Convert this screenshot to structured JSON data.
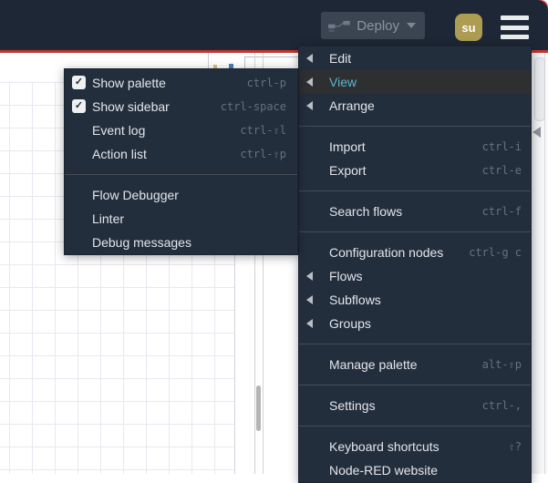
{
  "header": {
    "deploy_label": "Deploy",
    "avatar_initials": "su"
  },
  "main_menu": {
    "items": [
      {
        "label": "Edit",
        "submenu": true
      },
      {
        "label": "View",
        "submenu": true,
        "active": true
      },
      {
        "label": "Arrange",
        "submenu": true
      },
      {
        "separator": true
      },
      {
        "label": "Import",
        "shortcut": "ctrl-i"
      },
      {
        "label": "Export",
        "shortcut": "ctrl-e"
      },
      {
        "separator": true
      },
      {
        "label": "Search flows",
        "shortcut": "ctrl-f"
      },
      {
        "separator": true
      },
      {
        "label": "Configuration nodes",
        "shortcut": "ctrl-g c"
      },
      {
        "label": "Flows",
        "submenu": true
      },
      {
        "label": "Subflows",
        "submenu": true
      },
      {
        "label": "Groups",
        "submenu": true
      },
      {
        "separator": true
      },
      {
        "label": "Manage palette",
        "shortcut": "alt-⇧p"
      },
      {
        "separator": true
      },
      {
        "label": "Settings",
        "shortcut": "ctrl-,"
      },
      {
        "separator": true
      },
      {
        "label": "Keyboard shortcuts",
        "shortcut": "⇧?"
      },
      {
        "label": "Node-RED website"
      }
    ]
  },
  "view_submenu": {
    "items": [
      {
        "label": "Show palette",
        "checked": true,
        "shortcut": "ctrl-p"
      },
      {
        "label": "Show sidebar",
        "checked": true,
        "shortcut": "ctrl-space"
      },
      {
        "label": "Event log",
        "shortcut": "ctrl-⇧l"
      },
      {
        "label": "Action list",
        "shortcut": "ctrl-⇧p"
      },
      {
        "separator": true
      },
      {
        "label": "Flow Debugger"
      },
      {
        "label": "Linter"
      },
      {
        "label": "Debug messages"
      }
    ]
  },
  "icons": {
    "checkbox_checked": "✓",
    "submenu_arrow": "◀ (css triangle)",
    "dropdown_caret": "▾ (css triangle)",
    "hamburger": "≡ (3 bars)",
    "deploy": "node-wire glyph"
  },
  "colors": {
    "header_bg": "#1e2735",
    "menu_bg": "#232e3d",
    "accent_red": "#c33632",
    "active_item_text": "#58b7d6",
    "active_item_bg": "#2e2f31",
    "avatar_gold": "#ac9d53",
    "shortcut_text": "#667180"
  }
}
